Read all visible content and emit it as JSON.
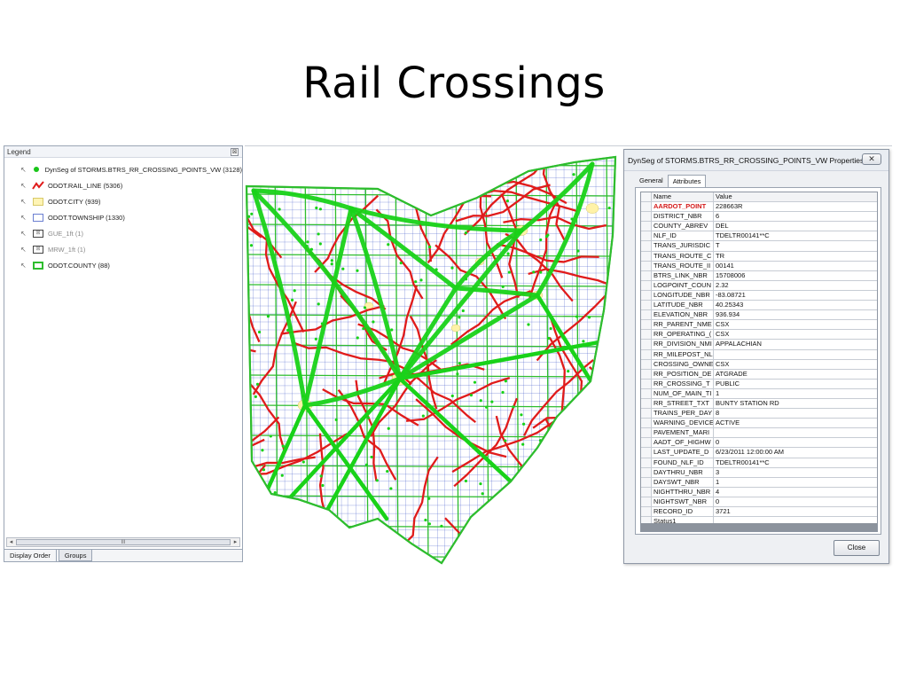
{
  "slide": {
    "title": "Rail Crossings"
  },
  "legend": {
    "header": "Legend",
    "close_glyph": "⊠",
    "items": [
      {
        "label": "DynSeg of STORMS.BTRS_RR_CROSSING_POINTS_VW (3128)",
        "symbol": "green-dot-icon"
      },
      {
        "label": "ODOT.RAIL_LINE (5306)",
        "symbol": "red-line-icon"
      },
      {
        "label": "ODOT.CITY (939)",
        "symbol": "yellow-polygon-icon"
      },
      {
        "label": "ODOT.TOWNSHIP (1330)",
        "symbol": "blue-outline-polygon-icon"
      },
      {
        "label": "GUE_1ft (1)",
        "symbol": "raster-icon"
      },
      {
        "label": "MRW_1ft (1)",
        "symbol": "raster-icon"
      },
      {
        "label": "ODOT.COUNTY (88)",
        "symbol": "green-outline-polygon-icon"
      }
    ],
    "scroll_thumb": "III",
    "tabs": [
      "Display Order",
      "Groups"
    ]
  },
  "dialog": {
    "title": "DynSeg of STORMS.BTRS_RR_CROSSING_POINTS_VW Properties",
    "close_glyph": "✕",
    "tabs": [
      "General",
      "Attributes"
    ],
    "columns": [
      "Name",
      "Value"
    ],
    "rows": [
      [
        "AARDOT_POINT",
        "228663R"
      ],
      [
        "DISTRICT_NBR",
        "6"
      ],
      [
        "COUNTY_ABREV",
        "DEL"
      ],
      [
        "NLF_ID",
        "TDELTR00141**C"
      ],
      [
        "TRANS_JURISDIC",
        "T"
      ],
      [
        "TRANS_ROUTE_C",
        "TR"
      ],
      [
        "TRANS_ROUTE_II",
        "00141"
      ],
      [
        "BTRS_LINK_NBR",
        "15708006"
      ],
      [
        "LOGPOINT_COUN",
        "2.32"
      ],
      [
        "LONGITUDE_NBR",
        "-83.08721"
      ],
      [
        "LATITUDE_NBR",
        "40.25343"
      ],
      [
        "ELEVATION_NBR",
        "936.934"
      ],
      [
        "RR_PARENT_NME",
        "CSX"
      ],
      [
        "RR_OPERATING_(",
        "CSX"
      ],
      [
        "RR_DIVISION_NMI",
        "APPALACHIAN"
      ],
      [
        "RR_MILEPOST_NL",
        ""
      ],
      [
        "CROSSING_OWNE",
        "CSX"
      ],
      [
        "RR_POSITION_DE",
        "ATGRADE"
      ],
      [
        "RR_CROSSING_T",
        "PUBLIC"
      ],
      [
        "NUM_OF_MAIN_TI",
        "1"
      ],
      [
        "RR_STREET_TXT",
        "BUNTY STATION RD"
      ],
      [
        "TRAINS_PER_DAY",
        "8"
      ],
      [
        "WARNING_DEVICE",
        "ACTIVE"
      ],
      [
        "PAVEMENT_MARI",
        ""
      ],
      [
        "AADT_OF_HIGHW",
        "0"
      ],
      [
        "LAST_UPDATE_D",
        "6/23/2011 12:00:00 AM"
      ],
      [
        "FOUND_NLF_ID",
        "TDELTR00141**C"
      ],
      [
        "DAYTHRU_NBR",
        "3"
      ],
      [
        "DAYSWT_NBR",
        "1"
      ],
      [
        "NIGHTTHRU_NBR",
        "4"
      ],
      [
        "NIGHTSWT_NBR",
        "0"
      ],
      [
        "RECORD_ID",
        "3721"
      ],
      [
        "Status1",
        ""
      ]
    ],
    "close_button": "Close"
  },
  "colors": {
    "county": "#2ebd2e",
    "crossings": "#19d219",
    "rail": "#e01b1b",
    "city": "#fff2a8",
    "township": "#3b54c9",
    "key_field": "#d41b1b"
  }
}
